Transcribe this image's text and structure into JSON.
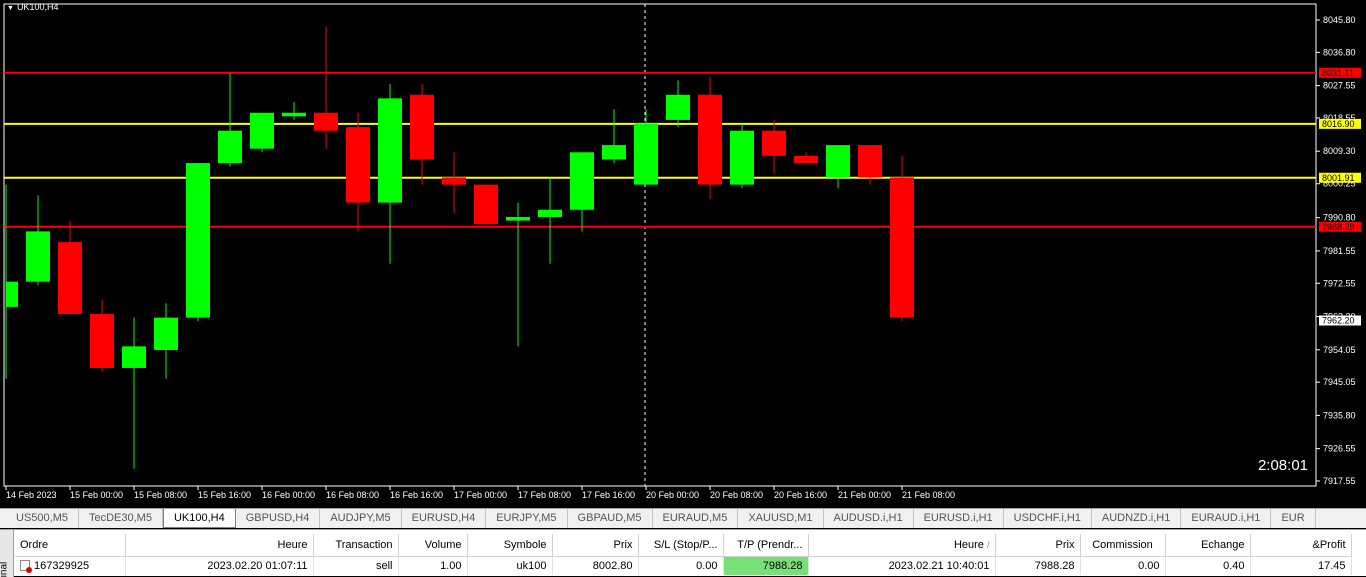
{
  "chart": {
    "symbol": "UK100,H4",
    "countdown": "2:08:01",
    "price_scale": [
      "8045.80",
      "8036.80",
      "8027.55",
      "8018.55",
      "8009.30",
      "8000.25",
      "7990.80",
      "7981.55",
      "7972.55",
      "7963.30",
      "7954.05",
      "7945.05",
      "7935.80",
      "7926.55",
      "7917.55"
    ],
    "time_labels": [
      "14 Feb 2023",
      "15 Feb 00:00",
      "15 Feb 08:00",
      "15 Feb 16:00",
      "16 Feb 00:00",
      "16 Feb 08:00",
      "16 Feb 16:00",
      "17 Feb 00:00",
      "17 Feb 08:00",
      "17 Feb 16:00",
      "20 Feb 00:00",
      "20 Feb 08:00",
      "20 Feb 16:00",
      "21 Feb 00:00",
      "21 Feb 08:00"
    ],
    "levels": [
      {
        "price": 8031.11,
        "label": "8031.11",
        "color": "#ff0000"
      },
      {
        "price": 8016.9,
        "label": "8016.90",
        "color": "#ffff00"
      },
      {
        "price": 8001.91,
        "label": "8001.91",
        "color": "#ffff00"
      },
      {
        "price": 7988.28,
        "label": "7988.28",
        "color": "#ff0000"
      }
    ],
    "current_price": "7962.20",
    "colors": {
      "bull": "#00ff00",
      "bear": "#ff0000",
      "background": "#000000",
      "grid_text": "#ffffff"
    }
  },
  "chart_data": {
    "type": "candlestick",
    "title": "UK100,H4",
    "ylim": [
      7917.55,
      8045.8
    ],
    "candles": [
      {
        "o": 7966,
        "h": 8000,
        "l": 7946,
        "c": 7973
      },
      {
        "o": 7973,
        "h": 7997,
        "l": 7972,
        "c": 7987
      },
      {
        "o": 7984,
        "h": 7990,
        "l": 7964,
        "c": 7964
      },
      {
        "o": 7964,
        "h": 7968,
        "l": 7948,
        "c": 7949
      },
      {
        "o": 7949,
        "h": 7963,
        "l": 7921,
        "c": 7955
      },
      {
        "o": 7954,
        "h": 7967,
        "l": 7946,
        "c": 7963
      },
      {
        "o": 7963,
        "h": 8006,
        "l": 7962,
        "c": 8006
      },
      {
        "o": 8006,
        "h": 8031,
        "l": 8005,
        "c": 8015
      },
      {
        "o": 8010,
        "h": 8020,
        "l": 8009,
        "c": 8020
      },
      {
        "o": 8019,
        "h": 8023,
        "l": 8018,
        "c": 8020
      },
      {
        "o": 8020,
        "h": 8044,
        "l": 8010,
        "c": 8015
      },
      {
        "o": 8016,
        "h": 8020,
        "l": 7987,
        "c": 7995
      },
      {
        "o": 7995,
        "h": 8028,
        "l": 7978,
        "c": 8024
      },
      {
        "o": 8025,
        "h": 8028,
        "l": 8000,
        "c": 8007
      },
      {
        "o": 8002,
        "h": 8009,
        "l": 7992,
        "c": 8000
      },
      {
        "o": 8000,
        "h": 8000,
        "l": 7989,
        "c": 7989
      },
      {
        "o": 7990,
        "h": 7995,
        "l": 7955,
        "c": 7991
      },
      {
        "o": 7991,
        "h": 8002,
        "l": 7978,
        "c": 7993
      },
      {
        "o": 7993,
        "h": 8009,
        "l": 7987,
        "c": 8009
      },
      {
        "o": 8007,
        "h": 8021,
        "l": 8006,
        "c": 8011
      },
      {
        "o": 8000,
        "h": 8021,
        "l": 8000,
        "c": 8017
      },
      {
        "o": 8018,
        "h": 8029,
        "l": 8016,
        "c": 8025
      },
      {
        "o": 8025,
        "h": 8030,
        "l": 7996,
        "c": 8000
      },
      {
        "o": 8000,
        "h": 8017,
        "l": 7999,
        "c": 8015
      },
      {
        "o": 8015,
        "h": 8018,
        "l": 8003,
        "c": 8008
      },
      {
        "o": 8008,
        "h": 8009,
        "l": 8006,
        "c": 8006
      },
      {
        "o": 8002,
        "h": 8011,
        "l": 7999,
        "c": 8011
      },
      {
        "o": 8011,
        "h": 8011,
        "l": 8000,
        "c": 8002
      },
      {
        "o": 8002,
        "h": 8008,
        "l": 7962,
        "c": 7963
      }
    ]
  },
  "tabs": [
    "US500,M5",
    "TecDE30,M5",
    "UK100,H4",
    "GBPUSD,H4",
    "AUDJPY,M5",
    "EURUSD,H4",
    "EURJPY,M5",
    "GBPAUD,M5",
    "EURAUD,M5",
    "XAUUSD,M1",
    "AUDUSD.i,H1",
    "EURUSD.i,H1",
    "USDCHF.i,H1",
    "AUDNZD.i,H1",
    "EURAUD.i,H1",
    "EUR"
  ],
  "active_tab": "UK100,H4",
  "terminal": {
    "side_label": "inal",
    "columns": [
      "Ordre",
      "Heure",
      "Transaction",
      "Volume",
      "Symbole",
      "Prix",
      "S/L (Stop/P...",
      "T/P (Prendr...",
      "Heure",
      "Prix",
      "Commission",
      "Echange",
      "&Profit"
    ],
    "sort_indicator": "/",
    "row": {
      "ordre": "167329925",
      "heure": "2023.02.20 01:07:11",
      "transaction": "sell",
      "volume": "1.00",
      "symbole": "uk100",
      "prix": "8002.80",
      "sl": "0.00",
      "tp": "7988.28",
      "heure2": "2023.02.21 10:40:01",
      "prix2": "7988.28",
      "commission": "0.00",
      "echange": "0.40",
      "profit": "17.45"
    }
  }
}
